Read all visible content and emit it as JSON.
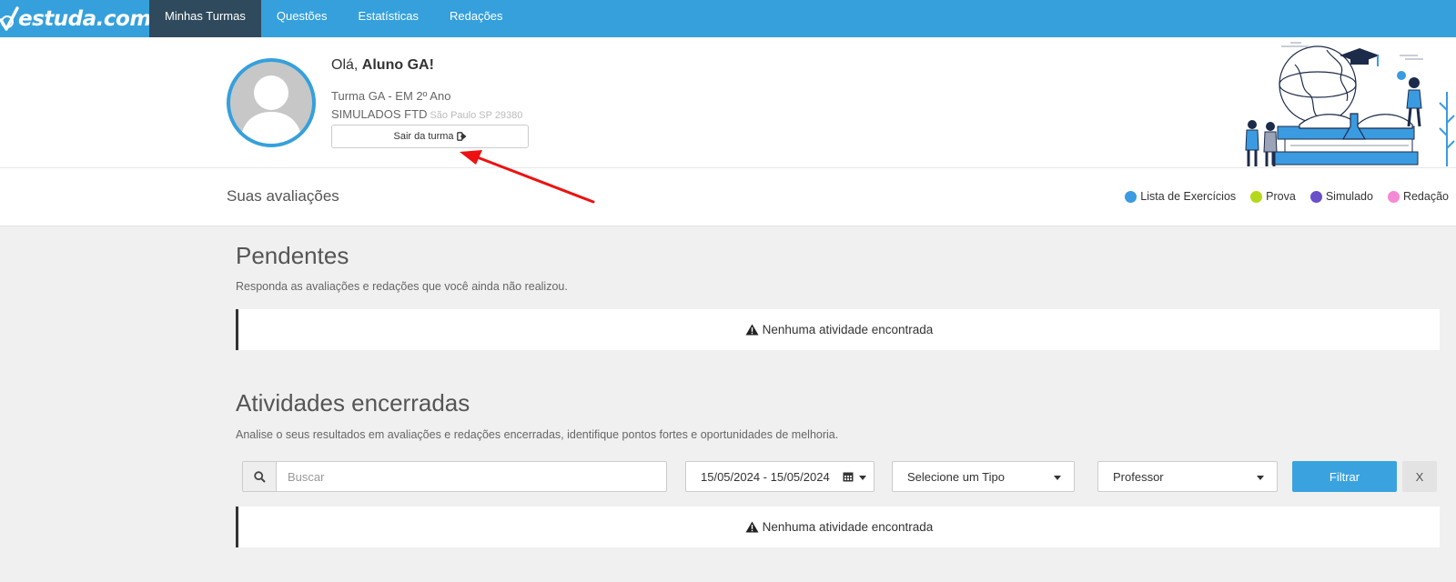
{
  "app": {
    "logo_text": "estuda.com"
  },
  "nav": {
    "items": [
      {
        "label": "Minhas Turmas",
        "active": true
      },
      {
        "label": "Questões",
        "active": false
      },
      {
        "label": "Estatísticas",
        "active": false
      },
      {
        "label": "Redações",
        "active": false
      }
    ]
  },
  "profile": {
    "greeting_prefix": "Olá, ",
    "name": "Aluno GA!",
    "turma": "Turma GA - EM 2º Ano",
    "school": "SIMULADOS FTD",
    "location": "São Paulo SP 29380",
    "leave_button": "Sair da turma",
    "leave_icon": "sign-out-icon"
  },
  "assessments": {
    "title": "Suas avaliações",
    "legend": [
      {
        "label": "Lista de Exercícios",
        "color": "#3a9be0"
      },
      {
        "label": "Prova",
        "color": "#b5d91a"
      },
      {
        "label": "Simulado",
        "color": "#6a50c8"
      },
      {
        "label": "Redação",
        "color": "#f48ad6"
      }
    ]
  },
  "pending": {
    "title": "Pendentes",
    "description": "Responda as avaliações e redações que você ainda não realizou.",
    "empty_message": "Nenhuma atividade encontrada"
  },
  "closed": {
    "title": "Atividades encerradas",
    "description": "Analise o seus resultados em avaliações e redações encerradas, identifique pontos fortes e oportunidades de melhoria.",
    "empty_message": "Nenhuma atividade encontrada",
    "filters": {
      "search_placeholder": "Buscar",
      "date_range": "15/05/2024 - 15/05/2024",
      "type_select": "Selecione um Tipo",
      "teacher_select": "Professor",
      "filter_button": "Filtrar",
      "clear_button": "X"
    }
  },
  "colors": {
    "topbar": "#35a0dc",
    "nav_active": "#2f4a5c",
    "accent": "#3aa3df",
    "annotation_arrow": "#ee1111"
  }
}
